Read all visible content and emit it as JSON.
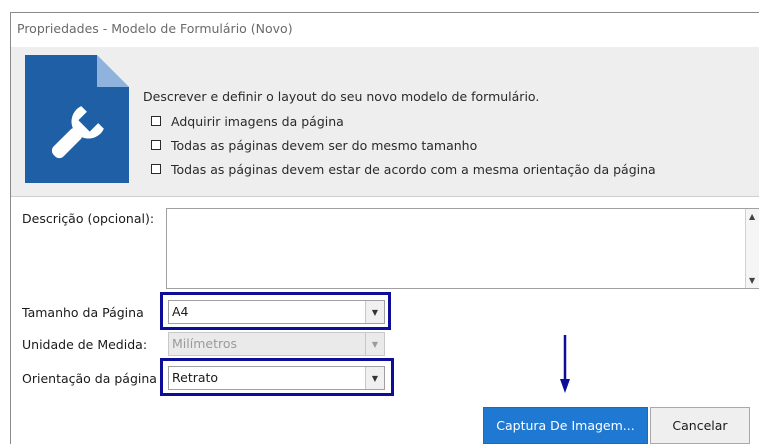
{
  "window": {
    "title": "Propriedades - Modelo de Formulário (Novo)"
  },
  "header": {
    "description": "Descrever e definir o layout do seu novo modelo de formulário.",
    "options": [
      "Adquirir imagens da página",
      "Todas as páginas devem ser do mesmo tamanho",
      "Todas as páginas devem estar de acordo com a mesma orientação da página"
    ],
    "icon": "document-wrench-icon",
    "accent": "#1f5fa6"
  },
  "form": {
    "description_label": "Descrição (opcional):",
    "description_value": "",
    "page_size_label": "Tamanho da Página",
    "page_size_value": "A4",
    "unit_label": "Unidade de Medida:",
    "unit_value": "Milímetros",
    "orientation_label": "Orientação da página",
    "orientation_value": "Retrato"
  },
  "buttons": {
    "capture_label": "Captura De Imagem...",
    "cancel_label": "Cancelar"
  },
  "annotation_color": "#0d0d9a"
}
